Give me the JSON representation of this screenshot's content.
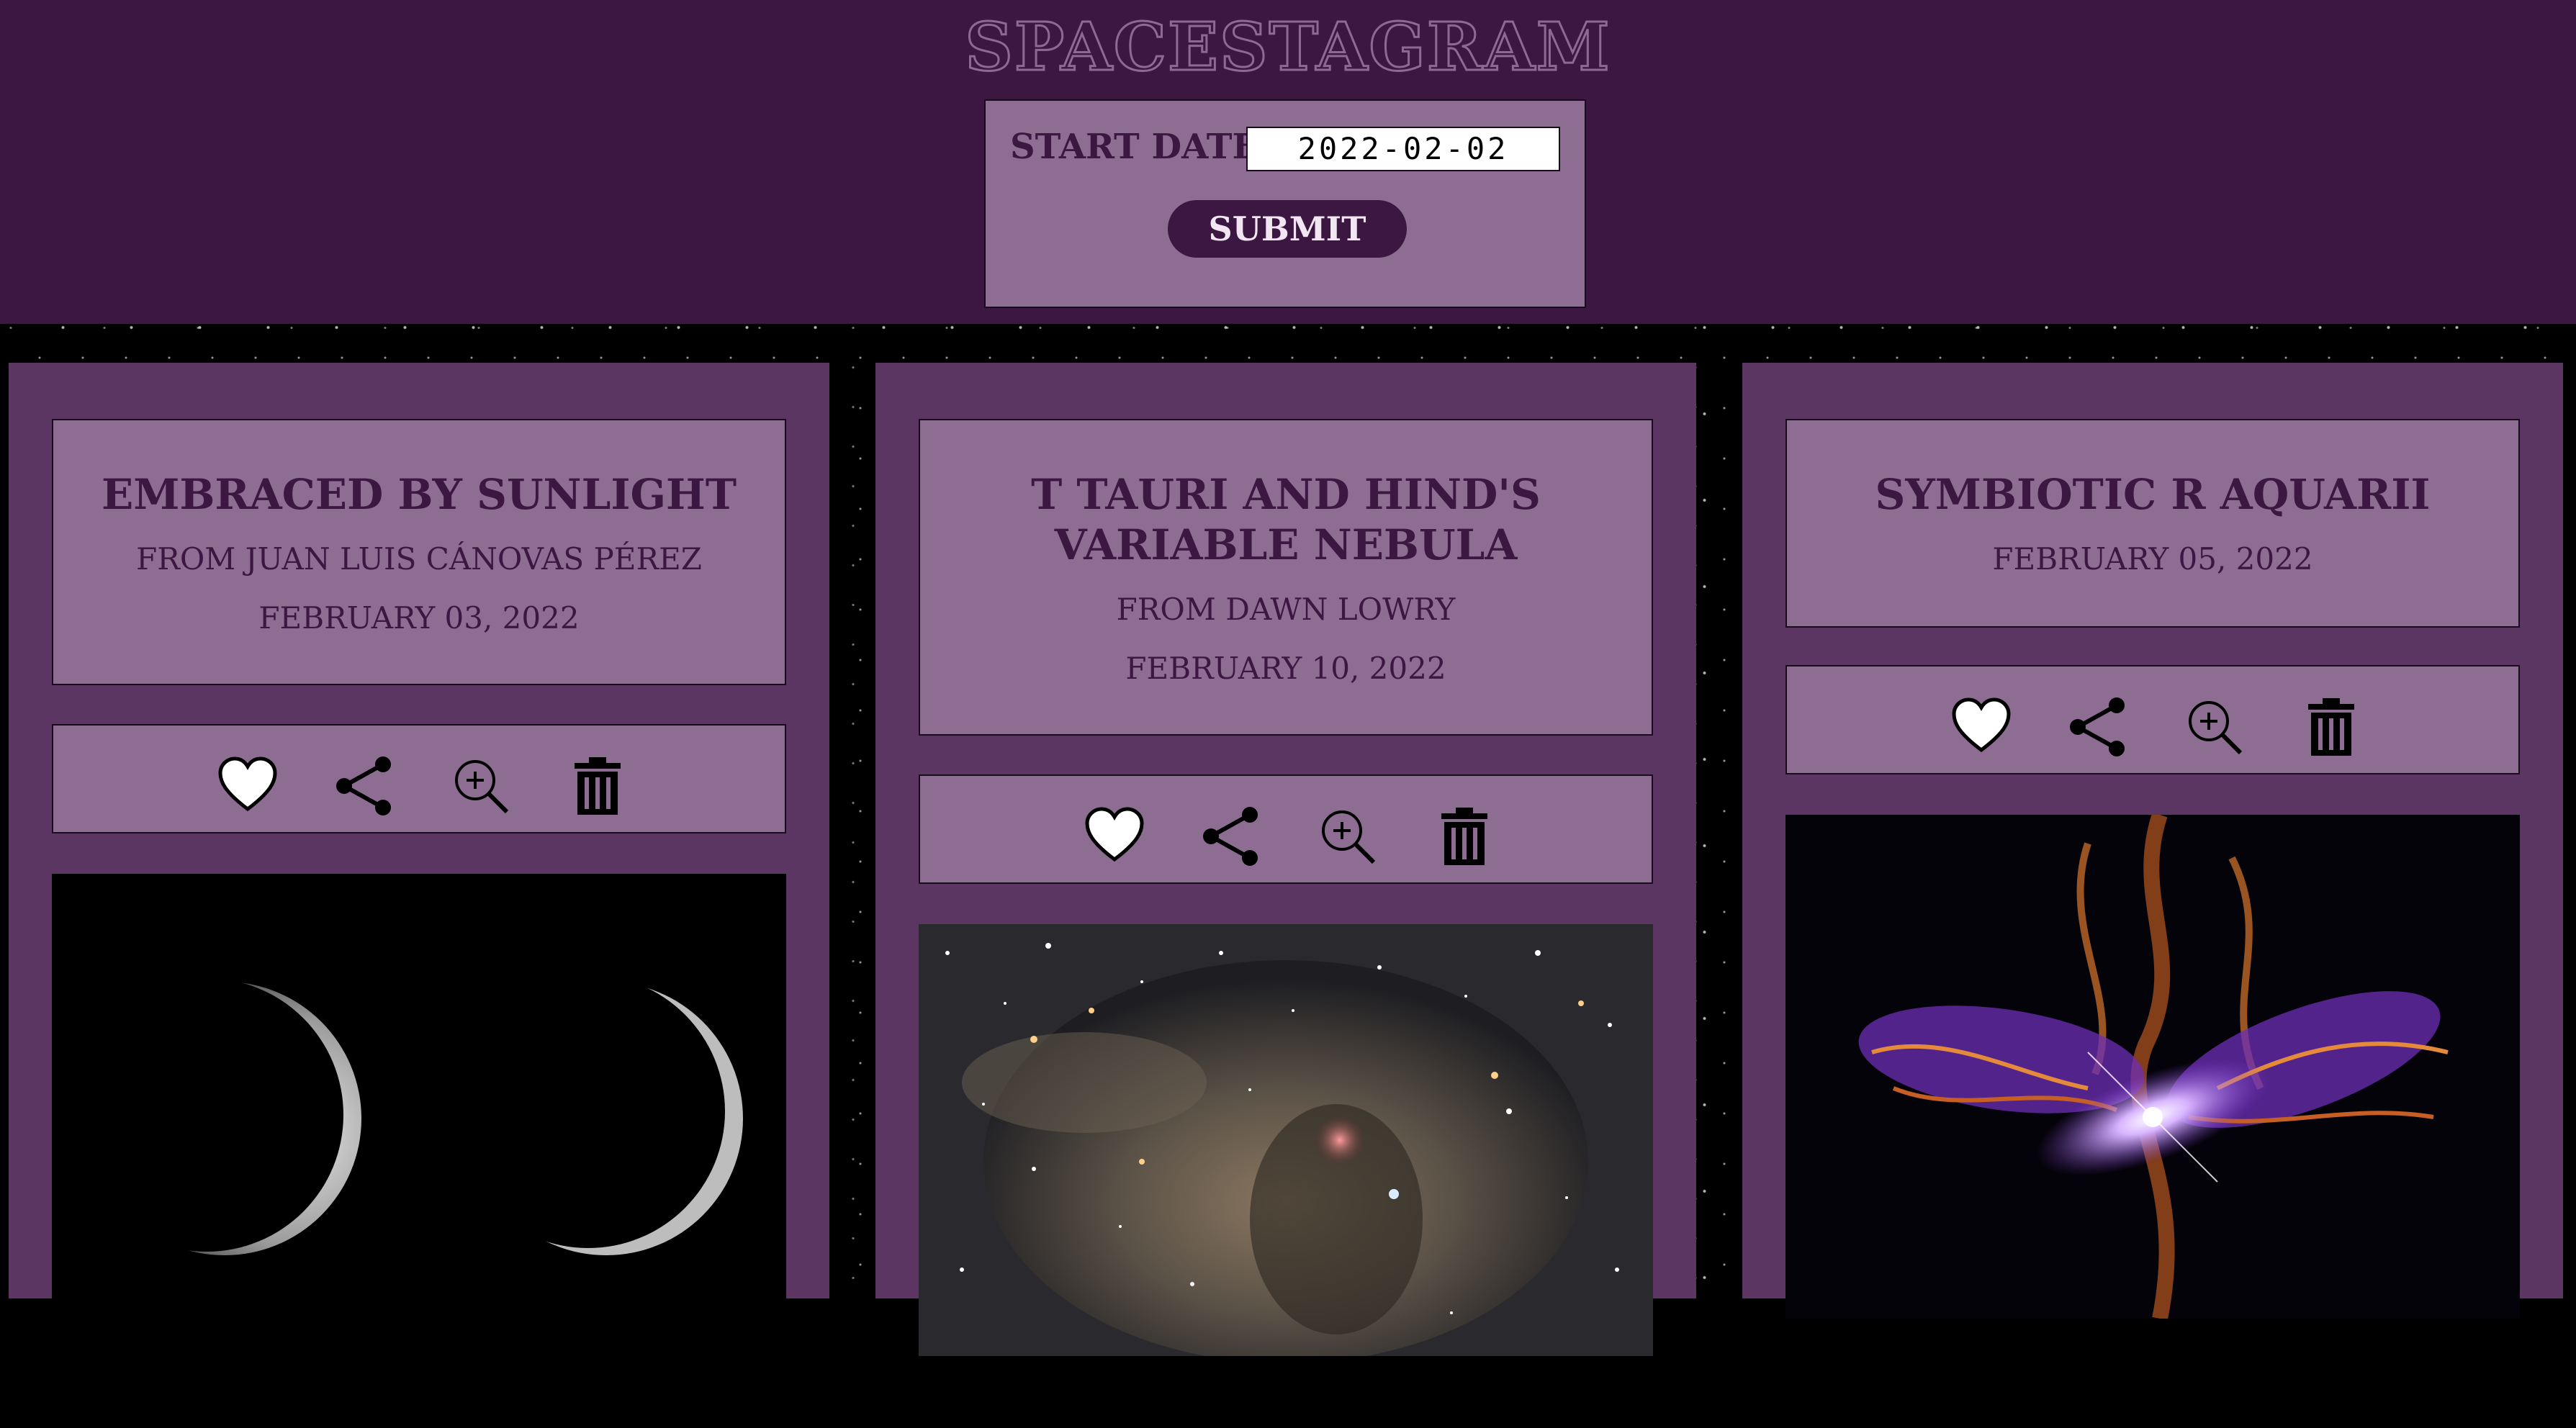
{
  "header": {
    "site_title": "SPACESTAGRAM",
    "start_date_label": "START DATE",
    "start_date_value": "2022-02-02",
    "submit_label": "SUBMIT"
  },
  "colors": {
    "header_bg": "#3b1742",
    "card_bg": "#5b3662",
    "box_bg": "#8e6d93",
    "text": "#3b1742"
  },
  "cards": [
    {
      "title": "EMBRACED BY SUNLIGHT",
      "credit": "FROM JUAN LUIS CÁNOVAS PÉREZ",
      "date": "FEBRUARY 03, 2022",
      "image": "two-crescent-moons"
    },
    {
      "title": "T TAURI AND HIND'S VARIABLE NEBULA",
      "credit": "FROM DAWN LOWRY",
      "date": "FEBRUARY 10, 2022",
      "image": "nebula-starfield"
    },
    {
      "title": "SYMBIOTIC R AQUARII",
      "credit": "",
      "date": "FEBRUARY 05, 2022",
      "image": "r-aquarii-nebula"
    }
  ],
  "actions": [
    "heart-icon",
    "share-icon",
    "zoom-in-icon",
    "trash-icon"
  ]
}
